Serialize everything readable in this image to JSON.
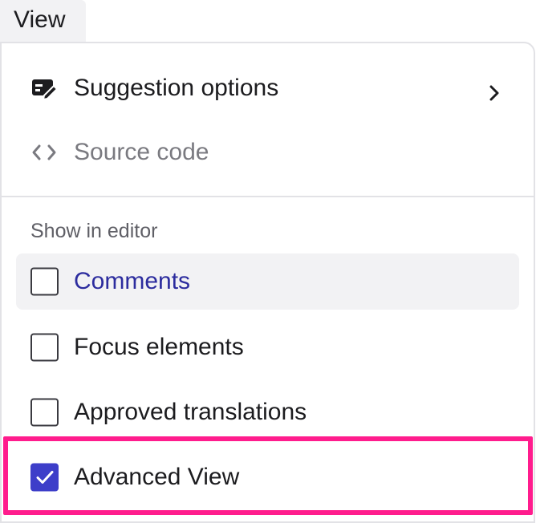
{
  "menubar": {
    "view_label": "View"
  },
  "menu": {
    "items": [
      {
        "label": "Suggestion options",
        "icon": "edit-suggestion-icon",
        "has_submenu": true
      },
      {
        "label": "Source code",
        "icon": "code-icon",
        "disabled": true
      }
    ],
    "section_label": "Show in editor",
    "checkboxes": [
      {
        "label": "Comments",
        "checked": false,
        "hovered": true
      },
      {
        "label": "Focus elements",
        "checked": false
      },
      {
        "label": "Approved translations",
        "checked": false
      },
      {
        "label": "Advanced View",
        "checked": true,
        "highlighted": true
      }
    ]
  },
  "colors": {
    "accent": "#3d3ec9",
    "highlight_border": "#ff1c8d",
    "hover_bg": "#f2f2f4",
    "hover_text": "#2c2c9e"
  }
}
